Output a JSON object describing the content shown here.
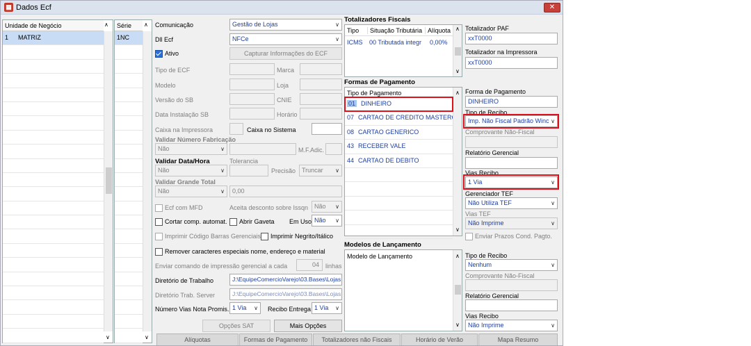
{
  "window": {
    "title": "Dados Ecf",
    "close_icon": "close-icon"
  },
  "unidades": {
    "header": "Unidade de Negócio",
    "rows": [
      {
        "code": "1",
        "name": "MATRIZ"
      }
    ]
  },
  "series": {
    "header": "Série",
    "rows": [
      "1NC"
    ]
  },
  "form": {
    "comunicacao_label": "Comunicação",
    "comunicacao_value": "Gestão de Lojas",
    "dll_label": "Dll Ecf",
    "dll_value": "NFCe",
    "ativo_label": "Ativo",
    "capturar_label": "Capturar Informações do ECF",
    "tipo_label": "Tipo de ECF",
    "marca_label": "Marca",
    "modelo_label": "Modelo",
    "loja_label": "Loja",
    "versao_label": "Versão do SB",
    "cnie_label": "CNIE",
    "data_label": "Data Instalação SB",
    "horario_label": "Horário",
    "caixa_imp_label": "Caixa na Impressora",
    "caixa_sis_label": "Caixa no Sistema",
    "validar_num_label": "Validar Número Fabricação",
    "validar_num_value": "Não",
    "mfadic_label": "M.F.Adic.",
    "validar_data_label": "Validar Data/Hora",
    "tolerancia_label": "Tolerancia",
    "validar_data_value": "Não",
    "precisao_label": "Precisão",
    "precisao_value": "Truncar",
    "validar_gt_label": "Validar Grande Total",
    "validar_gt_value": "Não",
    "gt_value": "0,00",
    "ecf_mfd_label": "Ecf com MFD",
    "aceita_desc_label": "Aceita desconto sobre Issqn",
    "aceita_desc_value": "Não",
    "cortar_label": "Cortar comp. automat.",
    "abrir_gaveta_label": "Abrir Gaveta",
    "em_uso_label": "Em Uso",
    "em_uso_value": "Não",
    "imprimir_cb_label": "Imprimir Código Barras Gerenciais",
    "imprimir_neg_label": "Imprimir Negrito/Itálico",
    "remover_label": "Remover caracteres especiais nome, endereço e material",
    "enviar_label": "Enviar comando de impressão gerencial a cada",
    "enviar_value": "04",
    "linhas_label": "linhas",
    "dir_trab_label": "Diretório de Trabalho",
    "dir_trab_value": "J:\\EquipeComercioVarejo\\03.Bases\\Lojas",
    "dir_server_label": "Diretório Trab. Server",
    "dir_server_value": "J:\\EquipeComercioVarejo\\03.Bases\\Lojas",
    "num_vias_label": "Número Vias Nota Promis.",
    "num_vias_value": "1 Via",
    "recibo_entrega_label": "Recibo Entrega",
    "recibo_entrega_value": "1 Via",
    "opcoes_sat_label": "Opções SAT",
    "mais_opcoes_label": "Mais Opções"
  },
  "totalizadores": {
    "title": "Totalizadores Fiscais",
    "headers": [
      "Tipo",
      "Situação Tributária",
      "Alíquota"
    ],
    "rows": [
      {
        "tipo": "ICMS",
        "situacao": "00 Tributada integr",
        "aliquota": "0,00%"
      }
    ],
    "paf_label": "Totalizador PAF",
    "paf_value": "xxT0000",
    "imp_label": "Totalizador na Impressora",
    "imp_value": "xxT0000"
  },
  "formas": {
    "title": "Formas de Pagamento",
    "header": "Tipo de Pagamento",
    "rows": [
      {
        "code": "01",
        "name": "DINHEIRO"
      },
      {
        "code": "07",
        "name": "CARTAO DE CREDITO MASTERCAR"
      },
      {
        "code": "08",
        "name": "CARTAO GENERICO"
      },
      {
        "code": "43",
        "name": "RECEBER VALE"
      },
      {
        "code": "44",
        "name": "CARTAO DE DEBITO"
      }
    ],
    "forma_label": "Forma de Pagamento",
    "forma_value": "DINHEIRO",
    "tipo_recibo_label": "Tipo de Recibo",
    "tipo_recibo_value": "Imp. Não Fiscal Padrão Winc",
    "comprovante_label": "Comprovante Não-Fiscal",
    "relatorio_label": "Relatório Gerencial",
    "vias_label": "Vias Recibo",
    "vias_value": "1 Via",
    "gerenciador_label": "Gerenciador TEF",
    "gerenciador_value": "Não Utiliza TEF",
    "vias_tef_label": "Vias TEF",
    "vias_tef_value": "Não Imprime",
    "enviar_prazos_label": "Enviar Prazos Cond. Pagto."
  },
  "modelos": {
    "title": "Modelos de Lançamento",
    "header": "Modelo de Lançamento",
    "tipo_recibo_label": "Tipo de Recibo",
    "tipo_recibo_value": "Nenhum",
    "comprovante_label": "Comprovante Não-Fiscal",
    "relatorio_label": "Relatório Gerencial",
    "vias_label": "Vias Recibo",
    "vias_value": "Não Imprime"
  },
  "tabs": [
    "Alíquotas",
    "Formas de Pagamento",
    "Totalizadores não Fiscais",
    "Horário de Verão",
    "Mapa Resumo"
  ]
}
